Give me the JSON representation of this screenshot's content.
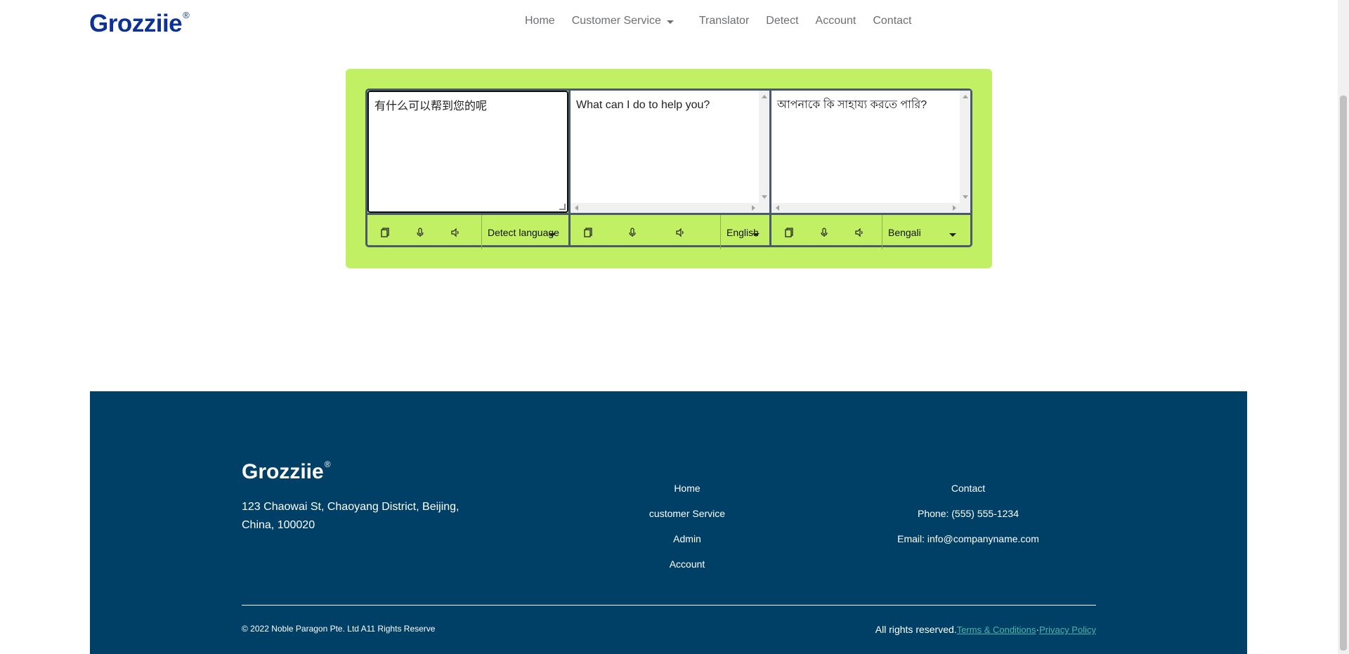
{
  "brand": {
    "name": "Grozziie",
    "mark": "®"
  },
  "nav": {
    "items": [
      {
        "label": "Home"
      },
      {
        "label": "Customer Service"
      },
      {
        "label": "Translator"
      },
      {
        "label": "Detect"
      },
      {
        "label": "Account"
      },
      {
        "label": "Contact"
      }
    ]
  },
  "translator": {
    "panes": [
      {
        "text": "有什么可以帮到您的呢",
        "language": "Detect language"
      },
      {
        "text": "What can I do to help you?",
        "language": "English"
      },
      {
        "text": "আপনাকে কি সাহায্য করতে পারি?",
        "language": "Bengali"
      }
    ],
    "icons": [
      "copy-icon",
      "microphone-icon",
      "speaker-icon"
    ]
  },
  "footer": {
    "brand": "Grozziie",
    "mark": "®",
    "address": "123 Chaowai St, Chaoyang District, Beijing, China, 100020",
    "links": [
      "Home",
      "customer Service",
      "Admin",
      "Account"
    ],
    "contact": {
      "title": "Contact",
      "phone": "Phone:  (555) 555-1234",
      "email": "Email:  info@companyname.com"
    },
    "copyright": "© 2022 Noble Paragon Pte. Ltd A11 Rights Reserve",
    "rights": "All rights reserved.",
    "terms": "Terms & Conditions",
    "separator": "·",
    "privacy": "Privacy Policy"
  },
  "colors": {
    "brand": "#0c3296",
    "panel": "#c1f065",
    "footer": "#004066",
    "footer_link": "#4fb3a7"
  }
}
